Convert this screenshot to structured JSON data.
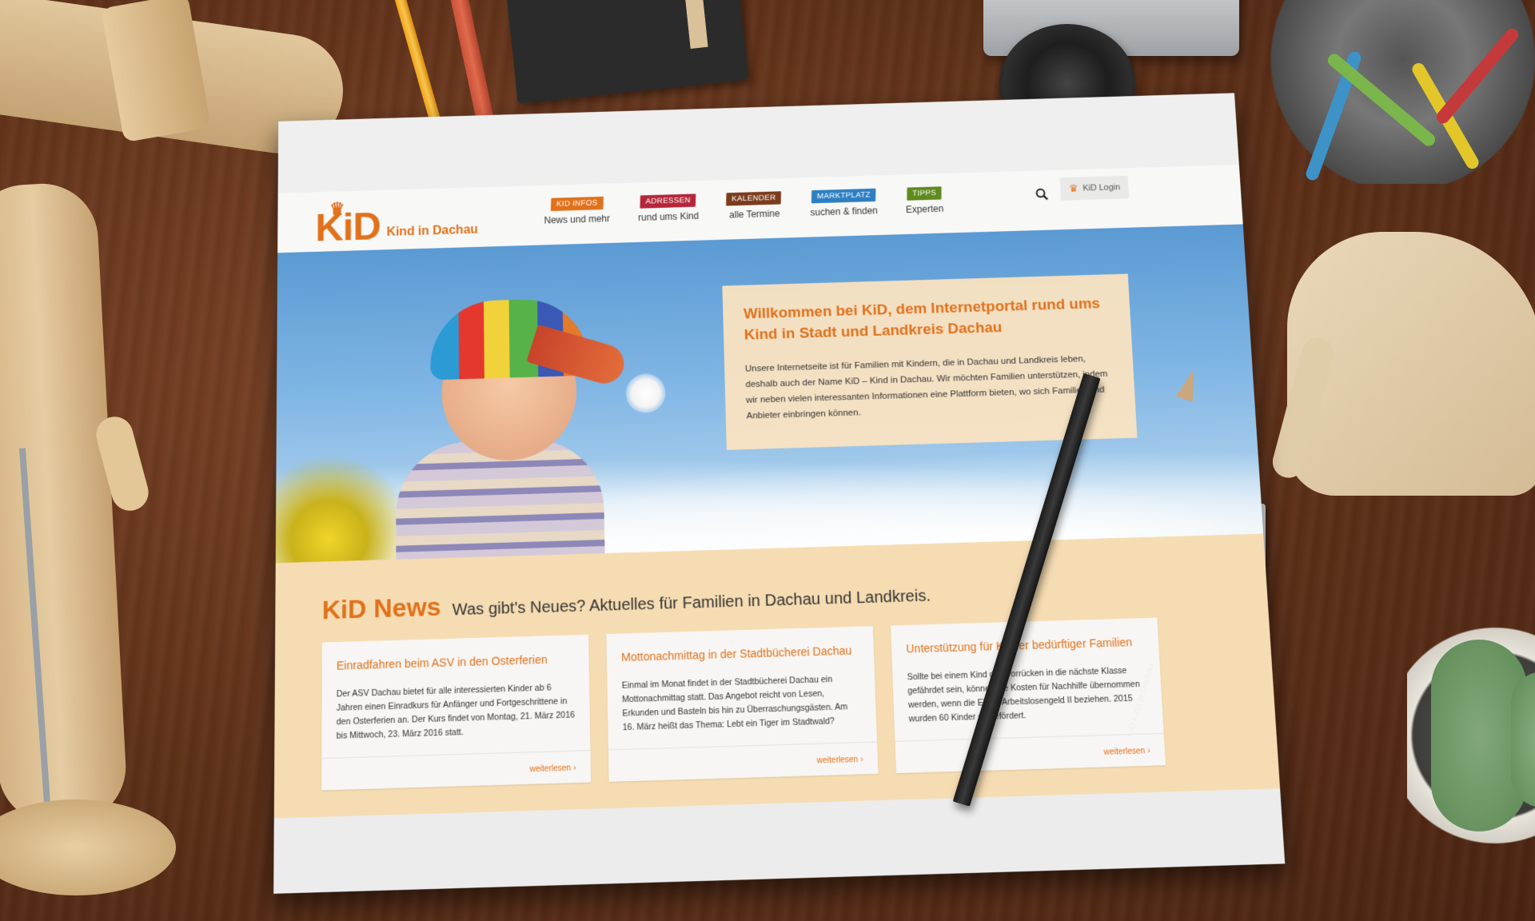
{
  "brand": {
    "logo_mark": "KiD",
    "logo_text": "Kind in Dachau",
    "accent": "#e1711b"
  },
  "nav": {
    "items": [
      {
        "tag": "KiD INFOS",
        "label": "News und mehr",
        "color": "#e1711b"
      },
      {
        "tag": "ADRESSEN",
        "label": "rund ums Kind",
        "color": "#b5263a"
      },
      {
        "tag": "KALENDER",
        "label": "alle Termine",
        "color": "#7a3c1c"
      },
      {
        "tag": "MARKTPLATZ",
        "label": "suchen & finden",
        "color": "#2d7fc2"
      },
      {
        "tag": "TIPPS",
        "label": "Experten",
        "color": "#5f8a1f"
      }
    ],
    "search_icon": "search-icon",
    "login_label": "KiD Login",
    "login_icon": "crown-icon"
  },
  "hero": {
    "title": "Willkommen bei KiD, dem Internetportal rund ums Kind in Stadt und Landkreis Dachau",
    "text": "Unsere Internetseite ist für Familien mit Kindern, die in Dachau und Landkreis leben, deshalb auch der Name KiD – Kind in Dachau. Wir möchten Familien unterstützen, indem wir neben vielen interessanten Informationen eine Plattform bieten, wo sich Familien und Anbieter einbringen können."
  },
  "news": {
    "title": "KiD News",
    "subtitle": "Was gibt's Neues? Aktuelles für Familien in Dachau und Landkreis.",
    "cards": [
      {
        "title": "Einradfahren beim ASV in den Osterferien",
        "text": "Der ASV Dachau bietet für alle interessierten Kinder ab 6 Jahren einen Einradkurs für Anfänger und Fortgeschrittene in den Osterferien an. Der Kurs findet von Montag, 21. März 2016 bis Mittwoch, 23. März 2016 statt.",
        "more": "weiterlesen"
      },
      {
        "title": "Mottonachmittag in der Stadtbücherei Dachau",
        "text": "Einmal im Monat findet in der Stadtbücherei Dachau ein Mottonachmittag statt. Das Angebot reicht von Lesen, Erkunden und Basteln bis hin zu Überraschungsgästen. Am 16. März heißt das Thema: Lebt ein Tiger im Stadtwald?",
        "more": "weiterlesen"
      },
      {
        "title": "Unterstützung für Kinder bedürftiger Familien",
        "text": "Sollte bei einem Kind das Vorrücken in die nächste Klasse gefährdet sein, können die Kosten für Nachhilfe übernommen werden, wenn die Eltern Arbeitslosengeld II beziehen. 2015 wurden 60 Kinder so gefördert.",
        "more": "weiterlesen"
      }
    ]
  },
  "props": {
    "pencil_label": "KiD Kind in Dachau"
  }
}
